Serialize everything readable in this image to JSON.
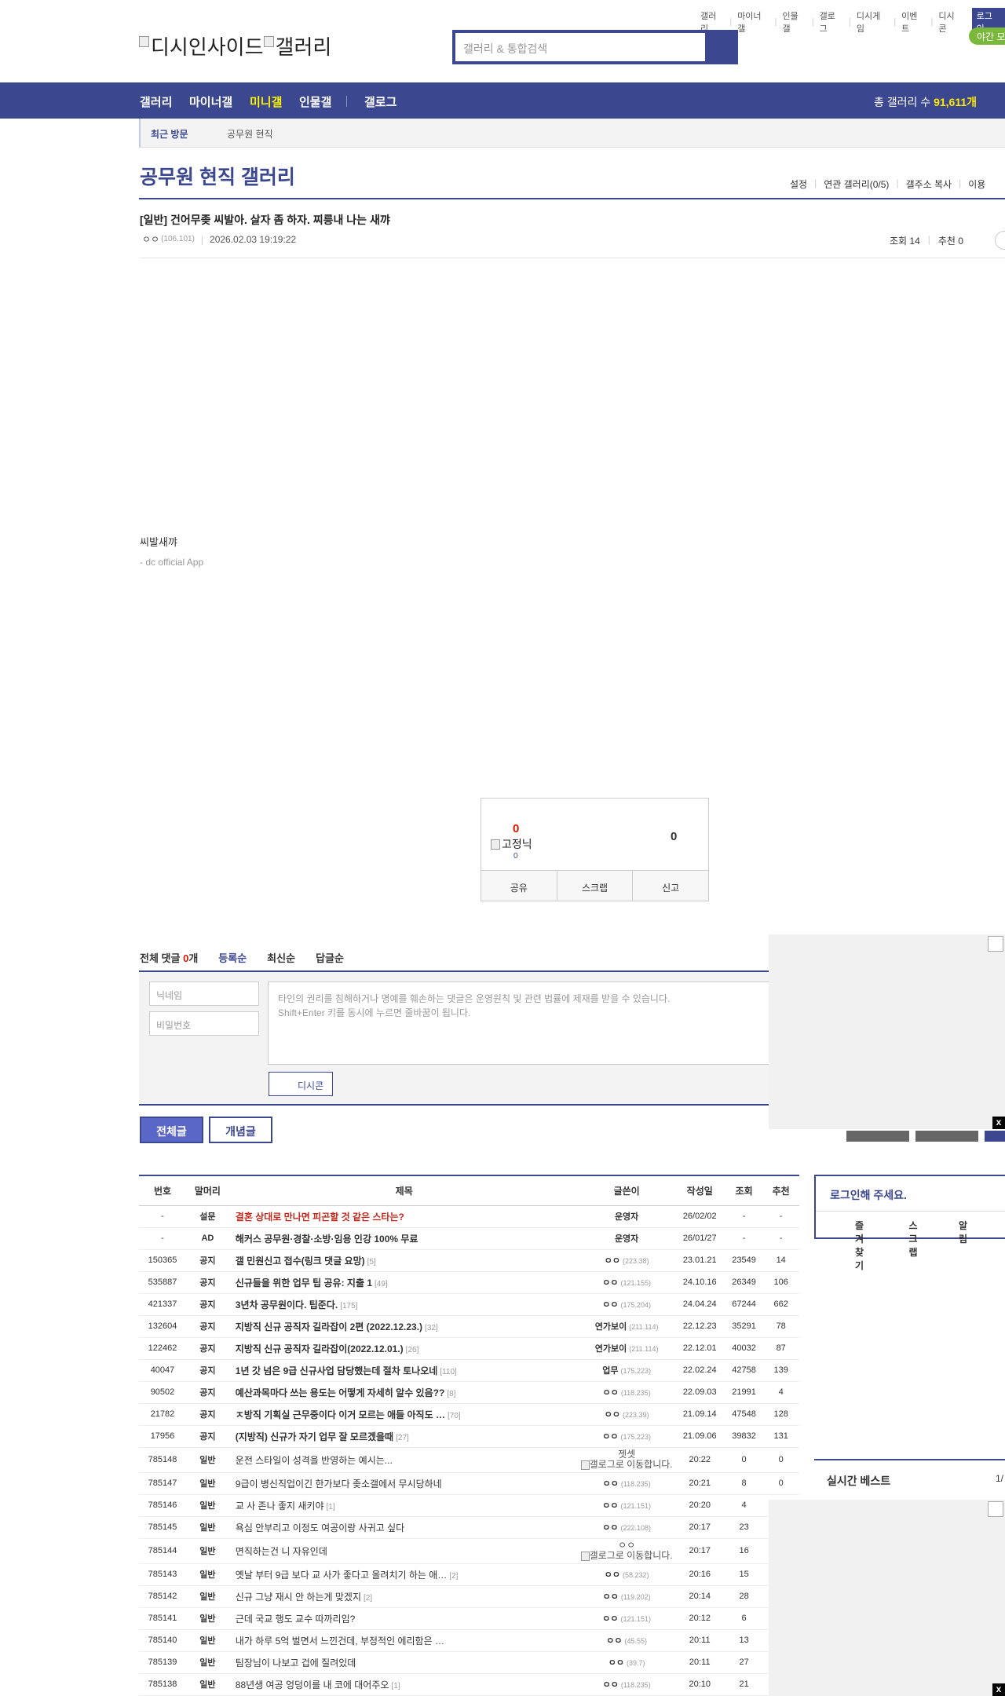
{
  "top_links": [
    "갤러리",
    "마이너갤",
    "인물갤",
    "갤로그",
    "디시게임",
    "이벤트",
    "디시콘"
  ],
  "login_label": "로그인",
  "night_mode_label": "야간 모드",
  "logo_alt": [
    "디시인사이드",
    "갤러리"
  ],
  "search": {
    "placeholder": "갤러리 & 통합검색"
  },
  "nav": {
    "items": [
      "갤러리",
      "마이너갤",
      "미니갤",
      "인물갤",
      "갤로그"
    ],
    "active": "미니갤",
    "total_label": "총 갤러리 수 ",
    "total_value": "91,611개"
  },
  "visit": {
    "label": "최근 방문",
    "item": "공무원 현직"
  },
  "gallery": {
    "name": "공무원 현직 갤러리",
    "tools": [
      "설정",
      "연관 갤러리(0/5)",
      "갤주소 복사",
      "이용"
    ]
  },
  "post": {
    "title": "[일반] 건어무좆 씨발아. 살자 좀 하자. 찌릉내 나는 새꺄",
    "writer": "ㅇㅇ",
    "ip": "(106.101)",
    "date": "2026.02.03 19:19:22",
    "views": "조회 14",
    "recommend": "추천 0",
    "body": "씨발새꺄",
    "app": "- dc official App"
  },
  "recommend_box": {
    "up": "0",
    "fixed_label": "고정닉",
    "fixed_count": "0",
    "down": "0",
    "actions": [
      "공유",
      "스크랩",
      "신고"
    ]
  },
  "comments": {
    "label": "전체 댓글 ",
    "count": "0",
    "unit": "개",
    "sorts": [
      "등록순",
      "최신순",
      "답글순"
    ],
    "nick_placeholder": "닉네임",
    "pw_placeholder": "비밀번호",
    "text_placeholder_1": "타인의 권리를 침해하거나 명예를 훼손하는 댓글은 운영원칙 및 관련 법률에 제재를 받을 수 있습니다.",
    "text_placeholder_2": "Shift+Enter 키를 동시에 누르면 줄바꿈이 됩니다.",
    "dccon": "디시콘"
  },
  "list_tabs": {
    "all": "전체글",
    "concept": "개념글"
  },
  "table": {
    "headers": [
      "번호",
      "말머리",
      "제목",
      "글쓴이",
      "작성일",
      "조회",
      "추천"
    ],
    "rows": [
      {
        "no": "-",
        "head": "설문",
        "title": "결혼 상대로 만나면 피곤할 것 같은 스타는?",
        "reply": "",
        "writer": "운영자",
        "ip": "",
        "date": "26/02/02",
        "views": "-",
        "rec": "-",
        "hot": true,
        "bold": true
      },
      {
        "no": "-",
        "head": "AD",
        "title": "해커스 공무원·경찰·소방·임용 인강 100% 무료",
        "reply": "",
        "writer": "운영자",
        "ip": "",
        "date": "26/01/27",
        "views": "-",
        "rec": "-",
        "hot": false,
        "bold": true
      },
      {
        "no": "150365",
        "head": "공지",
        "title": "갤 민원신고 접수(링크 댓글 요망)",
        "reply": "[5]",
        "writer": "ㅇㅇ",
        "ip": "(223.38)",
        "date": "23.01.21",
        "views": "23549",
        "rec": "14",
        "hot": false,
        "bold": true
      },
      {
        "no": "535887",
        "head": "공지",
        "title": "신규들을 위한 업무 팁 공유: 지출 1",
        "reply": "[49]",
        "writer": "ㅇㅇ",
        "ip": "(121.155)",
        "date": "24.10.16",
        "views": "26349",
        "rec": "106",
        "hot": false,
        "bold": true
      },
      {
        "no": "421337",
        "head": "공지",
        "title": "3년차 공무원이다. 팁준다.",
        "reply": "[175]",
        "writer": "ㅇㅇ",
        "ip": "(175.204)",
        "date": "24.04.24",
        "views": "67244",
        "rec": "662",
        "hot": false,
        "bold": true
      },
      {
        "no": "132604",
        "head": "공지",
        "title": "지방직 신규 공직자 길라잡이 2편 (2022.12.23.)",
        "reply": "[32]",
        "writer": "연가보이",
        "ip": "(211.114)",
        "date": "22.12.23",
        "views": "35291",
        "rec": "78",
        "hot": false,
        "bold": true
      },
      {
        "no": "122462",
        "head": "공지",
        "title": "지방직 신규 공직자 길라잡이(2022.12.01.)",
        "reply": "[26]",
        "writer": "연가보이",
        "ip": "(211.114)",
        "date": "22.12.01",
        "views": "40032",
        "rec": "87",
        "hot": false,
        "bold": true
      },
      {
        "no": "40047",
        "head": "공지",
        "title": "1년 갓 넘은 9급 신규사업 담당했는데 절차 토나오네",
        "reply": "[110]",
        "writer": "업무",
        "ip": "(175.223)",
        "date": "22.02.24",
        "views": "42758",
        "rec": "139",
        "hot": false,
        "bold": true
      },
      {
        "no": "90502",
        "head": "공지",
        "title": "예산과목마다 쓰는 용도는 어떻게 자세히 알수 있음??",
        "reply": "[8]",
        "writer": "ㅇㅇ",
        "ip": "(118.235)",
        "date": "22.09.03",
        "views": "21991",
        "rec": "4",
        "hot": false,
        "bold": true
      },
      {
        "no": "21782",
        "head": "공지",
        "title": "ㅈ방직 기획실 근무중이다 이거 모르는 애들 아직도 …",
        "reply": "[70]",
        "writer": "ㅇㅇ",
        "ip": "(223.39)",
        "date": "21.09.14",
        "views": "47548",
        "rec": "128",
        "hot": false,
        "bold": true
      },
      {
        "no": "17956",
        "head": "공지",
        "title": "(지방직) 신규가 자기 업무 잘 모르겠을때",
        "reply": "[27]",
        "writer": "ㅇㅇ",
        "ip": "(175.223)",
        "date": "21.09.06",
        "views": "39832",
        "rec": "131",
        "hot": false,
        "bold": true
      },
      {
        "no": "785148",
        "head": "일반",
        "title": "운전 스타일이 성격을 반영하는 예시는...",
        "reply": "",
        "writer": "젯셋",
        "ip": "",
        "gallog": "갤로그로 이동합니다.",
        "date": "20:22",
        "views": "0",
        "rec": "0",
        "hot": false,
        "bold": false
      },
      {
        "no": "785147",
        "head": "일반",
        "title": "9급이 병신직업이긴 한가보다 좆소갤에서 무시당하네",
        "reply": "",
        "writer": "ㅇㅇ",
        "ip": "(118.235)",
        "date": "20:21",
        "views": "8",
        "rec": "0",
        "hot": false,
        "bold": false
      },
      {
        "no": "785146",
        "head": "일반",
        "title": "교 사 존나 좋지 새키야",
        "reply": "[1]",
        "writer": "ㅇㅇ",
        "ip": "(121.151)",
        "date": "20:20",
        "views": "4",
        "rec": "",
        "hot": false,
        "bold": false
      },
      {
        "no": "785145",
        "head": "일반",
        "title": "욕심 안부리고 이정도 여공이랑 사귀고 싶다",
        "reply": "",
        "writer": "ㅇㅇ",
        "ip": "(222.108)",
        "date": "20:17",
        "views": "23",
        "rec": "",
        "hot": false,
        "bold": false
      },
      {
        "no": "785144",
        "head": "일반",
        "title": "면직하는건 니 자유인데",
        "reply": "",
        "writer": "ㅇㅇ",
        "ip": "",
        "gallog": "갤로그로 이동합니다.",
        "date": "20:17",
        "views": "16",
        "rec": "",
        "hot": false,
        "bold": false
      },
      {
        "no": "785143",
        "head": "일반",
        "title": "옛날 부터 9급 보다 교 사가 좋다고 올려치기 하는 애…",
        "reply": "[2]",
        "writer": "ㅇㅇ",
        "ip": "(58.232)",
        "date": "20:16",
        "views": "15",
        "rec": "",
        "hot": false,
        "bold": false
      },
      {
        "no": "785142",
        "head": "일반",
        "title": "신규 그냥 재시 안 하는게 맞겠지",
        "reply": "[2]",
        "writer": "ㅇㅇ",
        "ip": "(119.202)",
        "date": "20:14",
        "views": "28",
        "rec": "",
        "hot": false,
        "bold": false
      },
      {
        "no": "785141",
        "head": "일반",
        "title": "근데 국교 행도 교수 따까리임?",
        "reply": "",
        "writer": "ㅇㅇ",
        "ip": "(121.151)",
        "date": "20:12",
        "views": "6",
        "rec": "",
        "hot": false,
        "bold": false
      },
      {
        "no": "785140",
        "head": "일반",
        "title": "내가 하루 5억 벌면서 느낀건데, 부정적인 에리함은 …",
        "reply": "",
        "writer": "ㅇㅇ",
        "ip": "(45.55)",
        "date": "20:11",
        "views": "13",
        "rec": "",
        "hot": false,
        "bold": false
      },
      {
        "no": "785139",
        "head": "일반",
        "title": "팀장님이 나보고 겁에 질려있데",
        "reply": "",
        "writer": "ㅇㅇ",
        "ip": "(39.7)",
        "date": "20:11",
        "views": "27",
        "rec": "",
        "hot": false,
        "bold": false
      },
      {
        "no": "785138",
        "head": "일반",
        "title": "88년생 여공 엉덩이를 내 코에 대어주오",
        "reply": "[1]",
        "writer": "ㅇㅇ",
        "ip": "(118.235)",
        "date": "20:10",
        "views": "21",
        "rec": "",
        "hot": false,
        "bold": false
      }
    ]
  },
  "sidebar": {
    "login_title": "로그인해 주세요.",
    "login_links": [
      "즐겨찾기",
      "스크랩",
      "알림"
    ],
    "best_title": "실시간 베스트",
    "best_page": "1/"
  },
  "ad_close": "x"
}
